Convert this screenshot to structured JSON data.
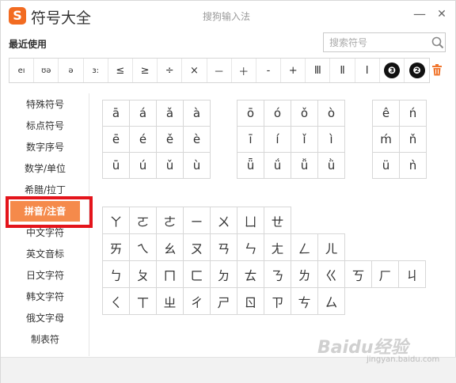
{
  "app": {
    "logo_letter": "S",
    "title": "符号大全",
    "subtitle": "搜狗输入法",
    "min_glyph": "—",
    "close_glyph": "✕"
  },
  "recent": {
    "label": "最近使用",
    "symbols": [
      "eı",
      "ʊə",
      "ə",
      "ɜ:",
      "≤",
      "≥",
      "÷",
      "×",
      "－",
      "＋",
      "-",
      "+",
      "Ⅲ",
      "Ⅱ",
      "Ⅰ",
      "❸",
      "❷"
    ]
  },
  "search": {
    "placeholder": "搜索符号"
  },
  "sidebar": {
    "items": [
      "特殊符号",
      "标点符号",
      "数字序号",
      "数学/单位",
      "希腊/拉丁",
      "拼音/注音",
      "中文字符",
      "英文音标",
      "日文字符",
      "韩文字符",
      "俄文字母",
      "制表符"
    ],
    "active_index": 5
  },
  "pinyin": {
    "group_a": [
      [
        "ā",
        "á",
        "ǎ",
        "à"
      ],
      [
        "ē",
        "é",
        "ě",
        "è"
      ],
      [
        "ū",
        "ú",
        "ǔ",
        "ù"
      ]
    ],
    "group_o": [
      [
        "ō",
        "ó",
        "ǒ",
        "ò"
      ],
      [
        "ī",
        "í",
        "ǐ",
        "ì"
      ],
      [
        "ǖ",
        "ǘ",
        "ǚ",
        "ǜ"
      ]
    ],
    "group_e": [
      [
        "ê",
        "ń"
      ],
      [
        "ḿ",
        "ň"
      ],
      [
        "ü",
        "ǹ"
      ]
    ]
  },
  "zhuyin": {
    "row1": [
      "ㄚ",
      "ㄛ",
      "ㄜ",
      "ㄧ",
      "ㄨ",
      "ㄩ",
      "ㄝ"
    ],
    "row2": [
      "ㄞ",
      "ㄟ",
      "ㄠ",
      "ㄡ",
      "ㄢ",
      "ㄣ",
      "ㄤ",
      "ㄥ",
      "ㄦ"
    ],
    "row3": [
      "ㄅ",
      "ㄆ",
      "ㄇ",
      "ㄈ",
      "ㄉ",
      "ㄊ",
      "ㄋ",
      "ㄌ",
      "ㄍ",
      "ㄎ",
      "ㄏ",
      "ㄐ"
    ],
    "row4": [
      "ㄑ",
      "ㄒ",
      "ㄓ",
      "ㄔ",
      "ㄕ",
      "ㄖ",
      "ㄗ",
      "ㄘ",
      "ㄙ"
    ]
  },
  "watermark": {
    "brand": "Baidu经验",
    "sub": "jingyan.baidu.com"
  },
  "colors": {
    "brand": "#f26b21",
    "active_tab": "#f58a4b",
    "highlight_frame": "#e4141b"
  }
}
